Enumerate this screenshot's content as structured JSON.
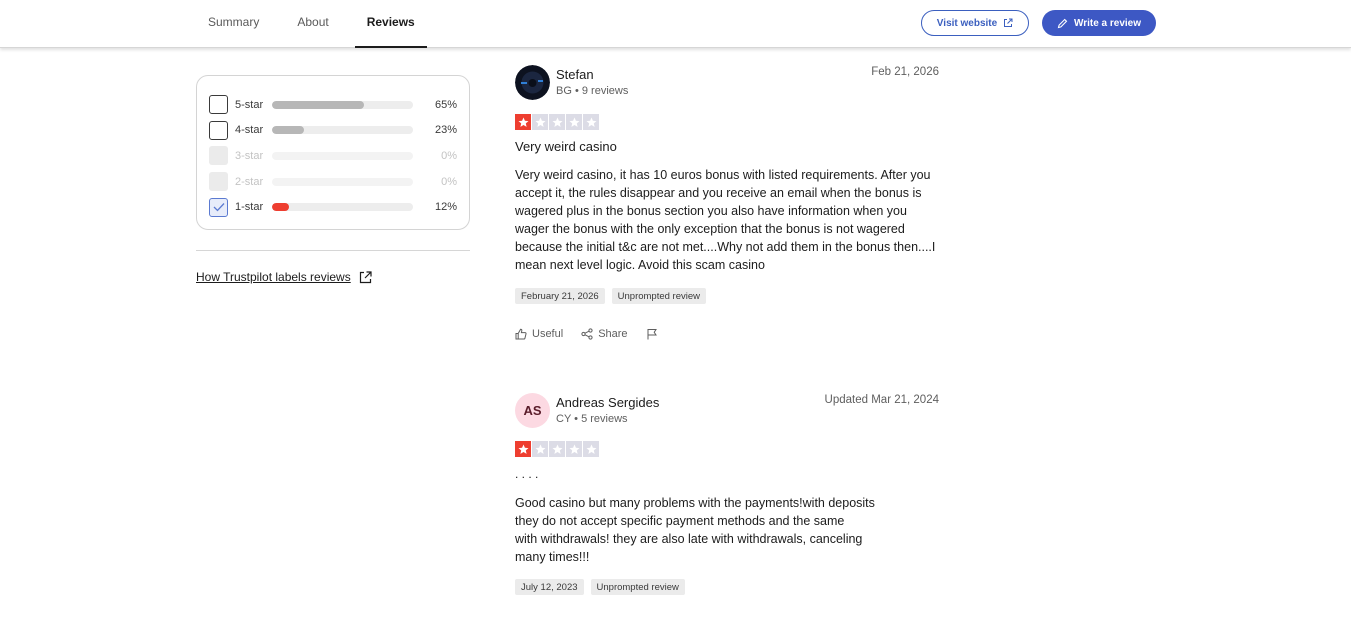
{
  "header": {
    "tabs": [
      {
        "label": "Summary"
      },
      {
        "label": "About"
      },
      {
        "label": "Reviews"
      }
    ],
    "visit_label": "Visit website",
    "write_label": "Write a review"
  },
  "filters": {
    "rows": [
      {
        "label": "5-star",
        "pct": "65%",
        "fraction": 0.65
      },
      {
        "label": "4-star",
        "pct": "23%",
        "fraction": 0.23
      },
      {
        "label": "3-star",
        "pct": "0%",
        "fraction": 0
      },
      {
        "label": "2-star",
        "pct": "0%",
        "fraction": 0
      },
      {
        "label": "1-star",
        "pct": "12%",
        "fraction": 0.12
      }
    ],
    "link_label": "How Trustpilot labels reviews"
  },
  "reviews": [
    {
      "name": "Stefan",
      "country": "BG",
      "review_count": "9 reviews",
      "date": "Feb 21, 2026",
      "rating": 1,
      "title": "Very weird casino",
      "body": "Very weird casino, it has 10 euros bonus with listed requirements. After you accept it, the rules disappear and you receive an email when the bonus is wagered plus in the bonus section you also have information when you wager the bonus with the only exception that the bonus is not wagered because the initial t&c are not met....Why not add them in the bonus then....I mean next level logic. Avoid this scam casino",
      "experience_date": "February 21, 2026",
      "tag": "Unprompted review",
      "useful_label": "Useful",
      "share_label": "Share"
    },
    {
      "name": "Andreas Sergides",
      "initials": "AS",
      "country": "CY",
      "review_count": "5 reviews",
      "date": "Updated Mar 21, 2024",
      "rating": 1,
      "title": ". . . .",
      "body": "Good casino but many problems with the payments!with deposits\nthey do not accept specific payment methods and the same\nwith withdrawals! they are also late with withdrawals, canceling\nmany times!!!",
      "experience_date": "July 12, 2023",
      "tag": "Unprompted review"
    }
  ],
  "colors": {
    "accent": "#3d58c4",
    "star_red": "#ee3e30",
    "star_empty": "#dcdce6",
    "bar_gray": "#b7b7b7"
  }
}
